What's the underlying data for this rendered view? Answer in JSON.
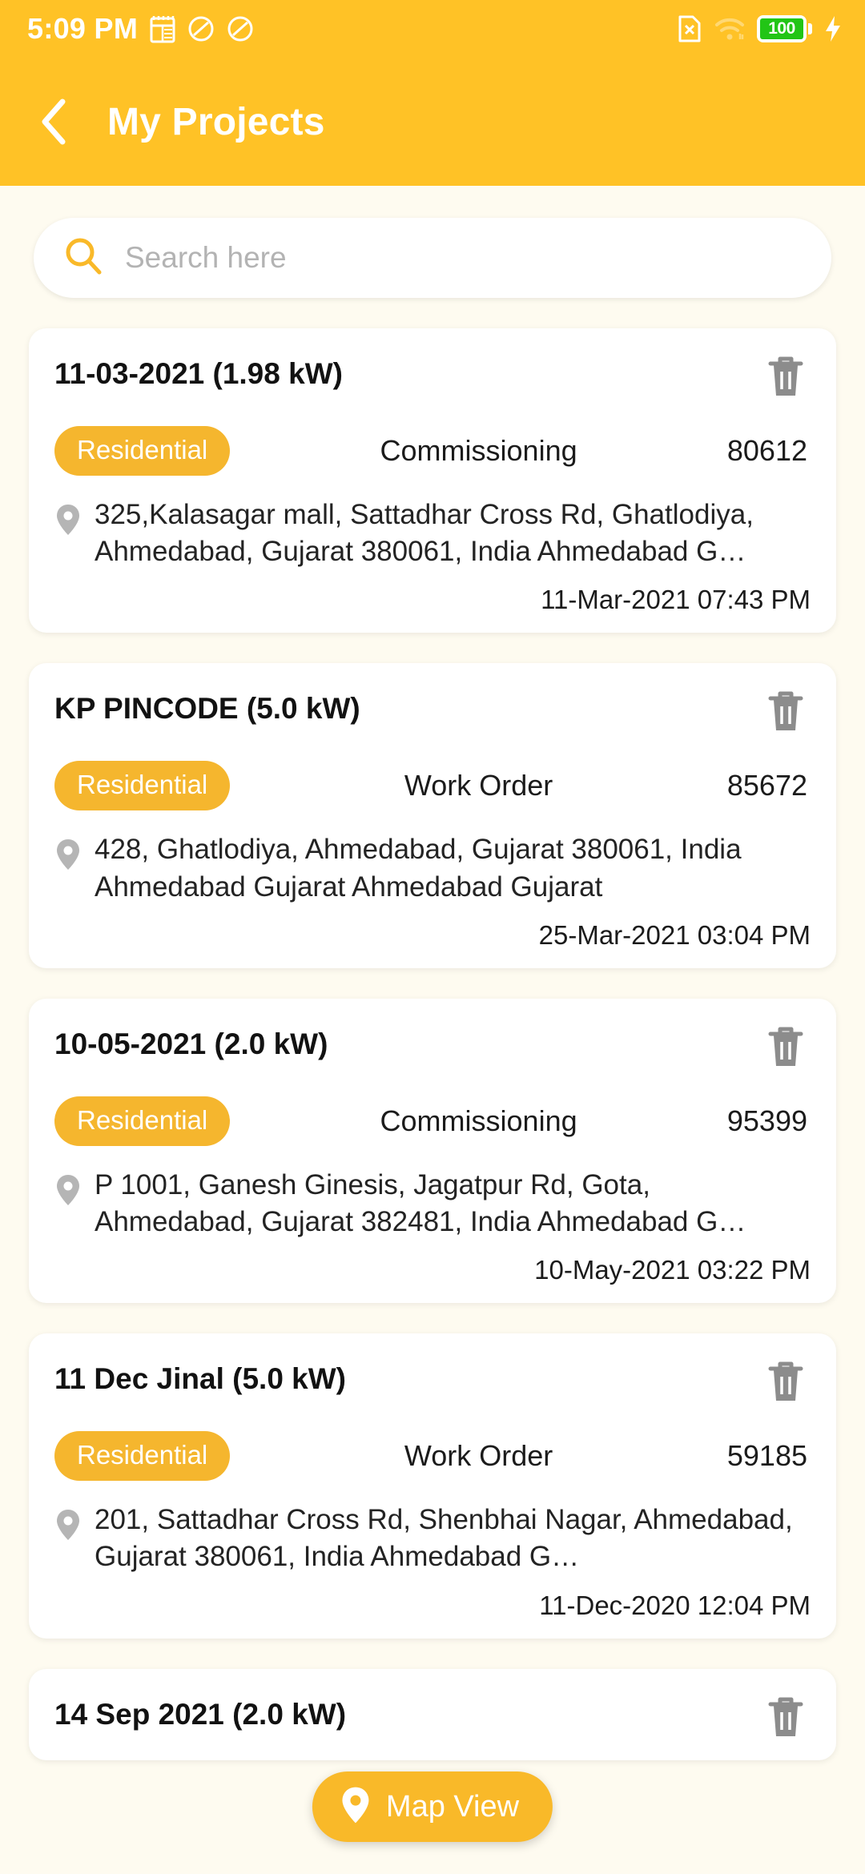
{
  "status_bar": {
    "time": "5:09 PM",
    "battery_level": "100",
    "icons_left": [
      "calendar-icon",
      "do-not-disturb-icon",
      "do-not-disturb-icon"
    ],
    "icons_right": [
      "no-sim-icon",
      "wifi-icon",
      "battery-icon",
      "charging-bolt-icon"
    ]
  },
  "app_bar": {
    "back_label": "back-arrow",
    "title": "My Projects"
  },
  "search": {
    "placeholder": "Search here",
    "value": ""
  },
  "fab": {
    "label": "Map View",
    "icon": "location-pin-icon"
  },
  "colors": {
    "header": "#FFC226",
    "accent": "#F5B62E",
    "background": "#FEFBF0",
    "card": "#FFFFFF",
    "battery_green": "#22C516"
  },
  "projects": [
    {
      "title": "11-03-2021 (1.98 kW)",
      "category": "Residential",
      "stage": "Commissioning",
      "id": "80612",
      "address": "325,Kalasagar mall, Sattadhar Cross Rd, Ghatlodiya, Ahmedabad, Gujarat 380061, India Ahmedabad G…",
      "date": "11-Mar-2021 07:43 PM"
    },
    {
      "title": "KP PINCODE (5.0 kW)",
      "category": "Residential",
      "stage": "Work Order",
      "id": "85672",
      "address": "428, Ghatlodiya, Ahmedabad, Gujarat 380061, India Ahmedabad Gujarat Ahmedabad Gujarat",
      "date": "25-Mar-2021 03:04 PM"
    },
    {
      "title": "10-05-2021 (2.0 kW)",
      "category": "Residential",
      "stage": "Commissioning",
      "id": "95399",
      "address": "P 1001, Ganesh Ginesis, Jagatpur Rd, Gota, Ahmedabad, Gujarat 382481, India Ahmedabad G…",
      "date": "10-May-2021 03:22 PM"
    },
    {
      "title": "11 Dec Jinal (5.0 kW)",
      "category": "Residential",
      "stage": "Work Order",
      "id": "59185",
      "address": "201, Sattadhar Cross Rd, Shenbhai Nagar, Ahmedabad, Gujarat 380061, India Ahmedabad G…",
      "date": "11-Dec-2020 12:04 PM"
    },
    {
      "title": "14 Sep 2021 (2.0 kW)",
      "category": "",
      "stage": "",
      "id": "",
      "address": "",
      "date": ""
    }
  ]
}
